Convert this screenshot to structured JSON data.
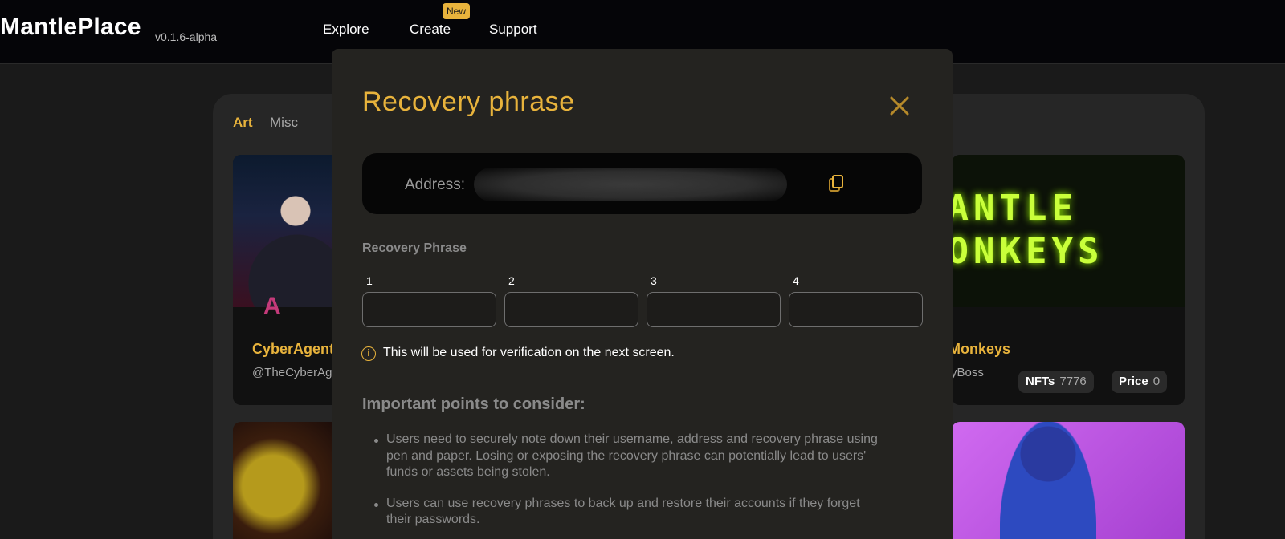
{
  "nav": {
    "brand": "MantlePlace",
    "version": "v0.1.6-alpha",
    "links": {
      "explore": "Explore",
      "create": "Create",
      "support": "Support"
    },
    "new_badge": "New"
  },
  "background": {
    "tabs": {
      "art": "Art",
      "misc": "Misc"
    },
    "cards": {
      "left_top": {
        "title": "CyberAgents",
        "creator": "@TheCyberAg"
      },
      "right_top": {
        "banner_line1": "MANTLE",
        "banner_line2": "MONKEYS",
        "title": "Monkeys",
        "creator": "yBoss",
        "nfts_label": "NFTs",
        "nfts_value": "7776",
        "price_label": "Price",
        "price_value": "0"
      }
    }
  },
  "modal": {
    "title": "Recovery phrase",
    "close_icon": "close-icon",
    "address_label": "Address:",
    "address_value": "",
    "copy_icon": "copy-icon",
    "recovery_label": "Recovery Phrase",
    "word_numbers": [
      "1",
      "2",
      "3",
      "4"
    ],
    "word_values": [
      "",
      "",
      "",
      ""
    ],
    "info_icon": "info-icon",
    "info_text": "This will be used for verification on the next screen.",
    "important_title": "Important points to consider:",
    "points": [
      "Users need to securely note down their username, address and recovery phrase using pen and paper. Losing or exposing the recovery phrase can potentially lead to users' funds or assets being stolen.",
      "Users can use recovery phrases to back up and restore their accounts if they forget their passwords."
    ]
  },
  "colors": {
    "accent": "#e8b33c",
    "background": "#1a1a1a",
    "navbar": "#050508",
    "modal": "#242320"
  }
}
